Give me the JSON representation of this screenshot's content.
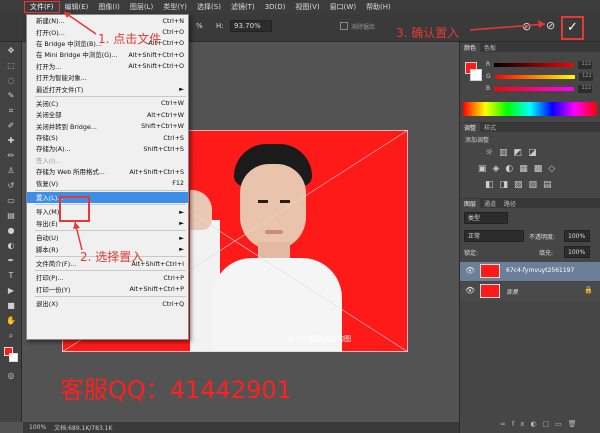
{
  "menubar": {
    "items": [
      "文件(F)",
      "编辑(E)",
      "图像(I)",
      "图层(L)",
      "类型(Y)",
      "选择(S)",
      "滤镜(T)",
      "3D(D)",
      "视图(V)",
      "窗口(W)",
      "帮助(H)"
    ]
  },
  "options": {
    "percent_w": "%",
    "h_label": "H:",
    "h_value": "93.70%",
    "antialias": "消除锯齿"
  },
  "filemenu": {
    "items": [
      {
        "label": "新建(N)...",
        "shortcut": "Ctrl+N"
      },
      {
        "label": "打开(O)...",
        "shortcut": "Ctrl+O"
      },
      {
        "label": "在 Bridge 中浏览(B)...",
        "shortcut": "Alt+Ctrl+O"
      },
      {
        "label": "在 Mini Bridge 中浏览(G)...",
        "shortcut": "Alt+Shift+Ctrl+O"
      },
      {
        "label": "打开为...",
        "shortcut": "Alt+Shift+Ctrl+O"
      },
      {
        "label": "打开为智能对象...",
        "shortcut": ""
      },
      {
        "label": "最近打开文件(T)",
        "shortcut": "►"
      },
      {
        "label": "关闭(C)",
        "shortcut": "Ctrl+W"
      },
      {
        "label": "关闭全部",
        "shortcut": "Alt+Ctrl+W"
      },
      {
        "label": "关闭并转到 Bridge...",
        "shortcut": "Shift+Ctrl+W"
      },
      {
        "label": "存储(S)",
        "shortcut": "Ctrl+S"
      },
      {
        "label": "存储为(A)...",
        "shortcut": "Shift+Ctrl+S"
      },
      {
        "label": "签入(I)...",
        "shortcut": ""
      },
      {
        "label": "存储为 Web 所用格式...",
        "shortcut": "Alt+Shift+Ctrl+S"
      },
      {
        "label": "恢复(V)",
        "shortcut": "F12"
      },
      {
        "label": "置入(L)...",
        "shortcut": ""
      },
      {
        "label": "导入(M)",
        "shortcut": "►"
      },
      {
        "label": "导出(E)",
        "shortcut": "►"
      },
      {
        "label": "自动(U)",
        "shortcut": "►"
      },
      {
        "label": "脚本(R)",
        "shortcut": "►"
      },
      {
        "label": "文件简介(F)...",
        "shortcut": "Alt+Shift+Ctrl+I"
      },
      {
        "label": "打印(P)...",
        "shortcut": "Ctrl+P"
      },
      {
        "label": "打印一份(Y)",
        "shortcut": "Alt+Shift+Ctrl+P"
      },
      {
        "label": "退出(X)",
        "shortcut": "Ctrl+Q"
      }
    ]
  },
  "annotations": {
    "step1": "1. 点击文件",
    "step2": "2. 选择置入",
    "step3": "3. 确认置入"
  },
  "watermark": "客服QQ：41442901",
  "photo_watermark": "@什么都能搞定的图",
  "status": {
    "zoom": "100%",
    "doc": "文档:689.1K/783.1K"
  },
  "panels": {
    "color_tabs": [
      "颜色",
      "色板"
    ],
    "r": "R",
    "g": "G",
    "b": "B",
    "val": "122",
    "adjust_tabs": [
      "调整",
      "样式"
    ],
    "adjust_title": "添加调整",
    "layers_tabs": [
      "图层",
      "通道",
      "路径"
    ],
    "kind": "类型",
    "blend": "正常",
    "opacity_label": "不透明度:",
    "opacity": "100%",
    "lock_label": "锁定:",
    "fill_label": "填充:",
    "fill": "100%",
    "layers": [
      {
        "name": "67c4-fymvuyt2561197"
      },
      {
        "name": "背景"
      }
    ]
  },
  "colors": {
    "accent_red": "#e53935",
    "menu_highlight": "#3d8ee8",
    "photo_bg": "#ff1a1a"
  }
}
